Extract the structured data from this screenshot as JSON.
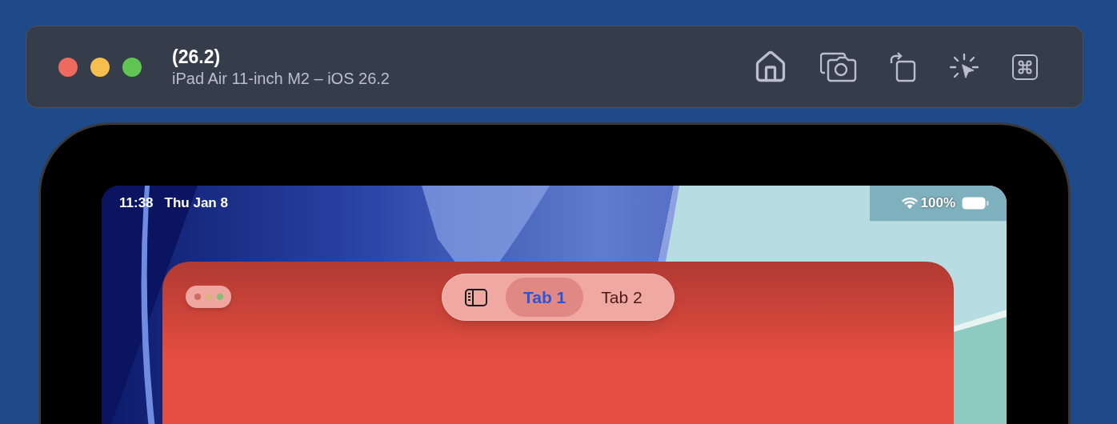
{
  "simulator": {
    "title": "(26.2)",
    "subtitle": "iPad Air 11-inch M2 – iOS 26.2"
  },
  "status_bar": {
    "time": "11:38",
    "date": "Thu Jan 8",
    "battery": "100%"
  },
  "tabs": [
    {
      "label": "Tab 1",
      "selected": true
    },
    {
      "label": "Tab 2",
      "selected": false
    }
  ]
}
